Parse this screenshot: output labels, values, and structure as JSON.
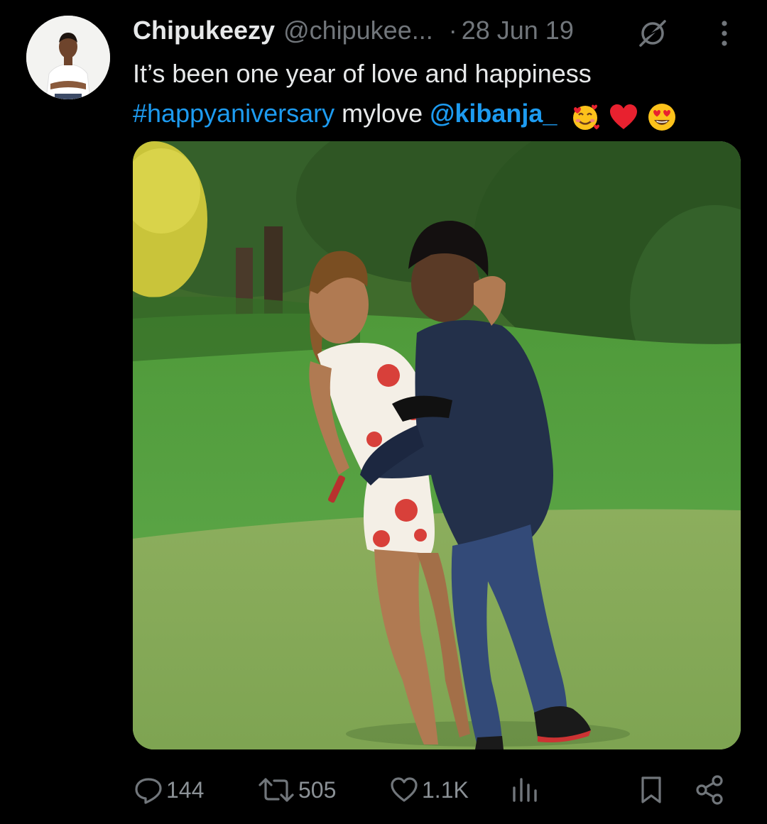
{
  "tweet": {
    "display_name": "Chipukeezy",
    "handle": "@chipukee...",
    "separator": "·",
    "timestamp": "28 Jun 19",
    "text_line1": "It’s been one year of love and happiness",
    "hashtag": "#happyaniversary",
    "text_mid": " mylove ",
    "mention": "@kibanja_",
    "emojis": [
      "smiling-face-with-hearts",
      "red-heart",
      "heart-eyes"
    ]
  },
  "actions": {
    "replies": "144",
    "retweets": "505",
    "likes": "1.1K"
  },
  "colors": {
    "background": "#000000",
    "text": "#e7e9ea",
    "secondary": "#71767b",
    "link": "#1d9bf0"
  },
  "icons": {
    "reply": "reply-icon",
    "retweet": "retweet-icon",
    "like": "heart-icon",
    "views": "analytics-icon",
    "bookmark": "bookmark-icon",
    "share": "share-icon",
    "grok": "grok-icon",
    "more": "more-icon"
  }
}
